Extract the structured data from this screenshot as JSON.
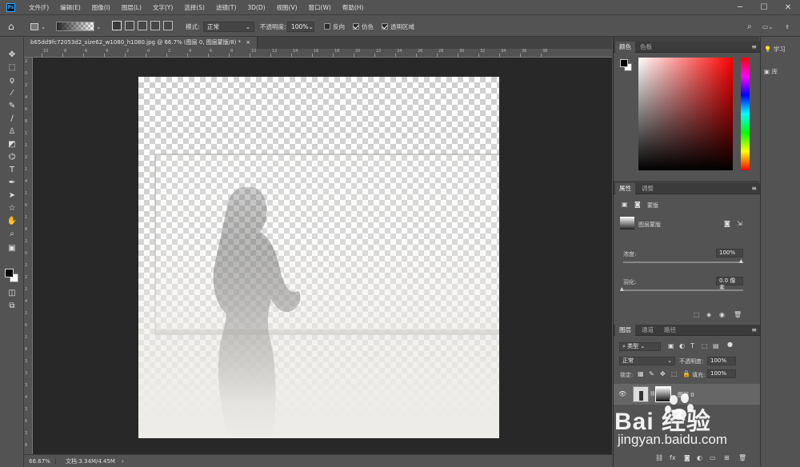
{
  "menubar": {
    "logo": "Ps",
    "items": [
      "文件(F)",
      "编辑(E)",
      "图像(I)",
      "图层(L)",
      "文字(Y)",
      "选择(S)",
      "滤镜(T)",
      "3D(D)",
      "视图(V)",
      "窗口(W)",
      "帮助(H)"
    ],
    "min": "─",
    "max": "☐",
    "close": "✕"
  },
  "options": {
    "mode_label": "模式:",
    "mode_value": "正常",
    "opacity_label": "不透明度:",
    "opacity_value": "100%",
    "reverse_label": "反向",
    "dither_label": "仿色",
    "transparency_label": "透明区域"
  },
  "document": {
    "tab_title": "b65dd9fc72053d2_size62_w1080_h1080.jpg @ 66.7% (图层 0, 图层蒙版/8) *",
    "tab_close": "×"
  },
  "ruler": {
    "top": [
      "10",
      "8",
      "6",
      "4",
      "2",
      "0",
      "2",
      "4",
      "6",
      "8",
      "10",
      "12",
      "14",
      "16",
      "18",
      "20",
      "22",
      "24",
      "26",
      "28",
      "30",
      "32",
      "34",
      "36",
      "38"
    ],
    "left": [
      "2",
      "0",
      "2",
      "4",
      "6",
      "8",
      "1",
      "1",
      "2",
      "1",
      "4",
      "1",
      "6",
      "1",
      "8",
      "2",
      "0",
      "2",
      "2",
      "2",
      "4",
      "2",
      "6",
      "2",
      "8",
      "3",
      "3",
      "3",
      "4",
      "3",
      "6",
      "3",
      "8"
    ]
  },
  "status": {
    "zoom": "66.67%",
    "doc_info": "文档:3.34M/4.45M",
    "arrow": "›"
  },
  "color_panel": {
    "tabs": [
      "颜色",
      "色板"
    ]
  },
  "properties_panel": {
    "tabs": [
      "属性",
      "调整"
    ],
    "mask_type": "蒙版",
    "mask_name": "图层蒙版",
    "density_label": "浓度:",
    "density_value": "100%",
    "feather_label": "羽化:",
    "feather_value": "0.0 像素"
  },
  "layers_panel": {
    "tabs": [
      "图层",
      "通道",
      "路径"
    ],
    "filter_label": "类型",
    "blend_mode": "正常",
    "opacity_label": "不透明度:",
    "opacity_value": "100%",
    "lock_label": "锁定:",
    "fill_label": "填充:",
    "fill_value": "100%",
    "layer_name": "图层 0"
  },
  "far_right": {
    "learn": "学习",
    "library": "库"
  },
  "watermark": {
    "logo_text": "Bai   经验",
    "url": "jingyan.baidu.com"
  },
  "colors": {
    "fg": "#000000",
    "bg": "#ffffff",
    "accent": "#31a8ff"
  }
}
